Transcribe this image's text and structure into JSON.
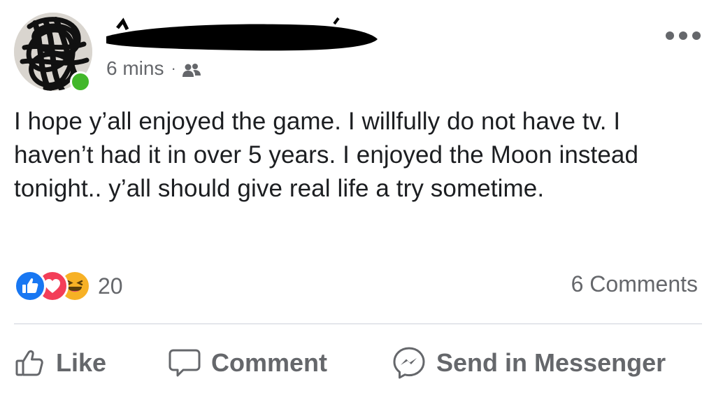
{
  "post": {
    "timestamp": "6 mins",
    "separator": "·",
    "audience_icon": "friends-icon",
    "more_icon": "more-options-icon",
    "text": "I hope y’all enjoyed the game. I willfully do not have tv. I haven’t had it in over 5 years. I enjoyed the Moon instead tonight.. y’all should give real life a try sometime.",
    "reactions": {
      "icons": [
        "like-reaction-icon",
        "love-reaction-icon",
        "haha-reaction-icon"
      ],
      "count": "20"
    },
    "comments_label": "6 Comments"
  },
  "actions": {
    "like_label": "Like",
    "comment_label": "Comment",
    "send_label": "Send in Messenger"
  },
  "colors": {
    "like_blue": "#1877f2",
    "love_red": "#f33e58",
    "haha_yellow": "#f7b125",
    "online_green": "#42b72a",
    "secondary_text": "#65676b",
    "primary_text": "#1c1e21"
  }
}
